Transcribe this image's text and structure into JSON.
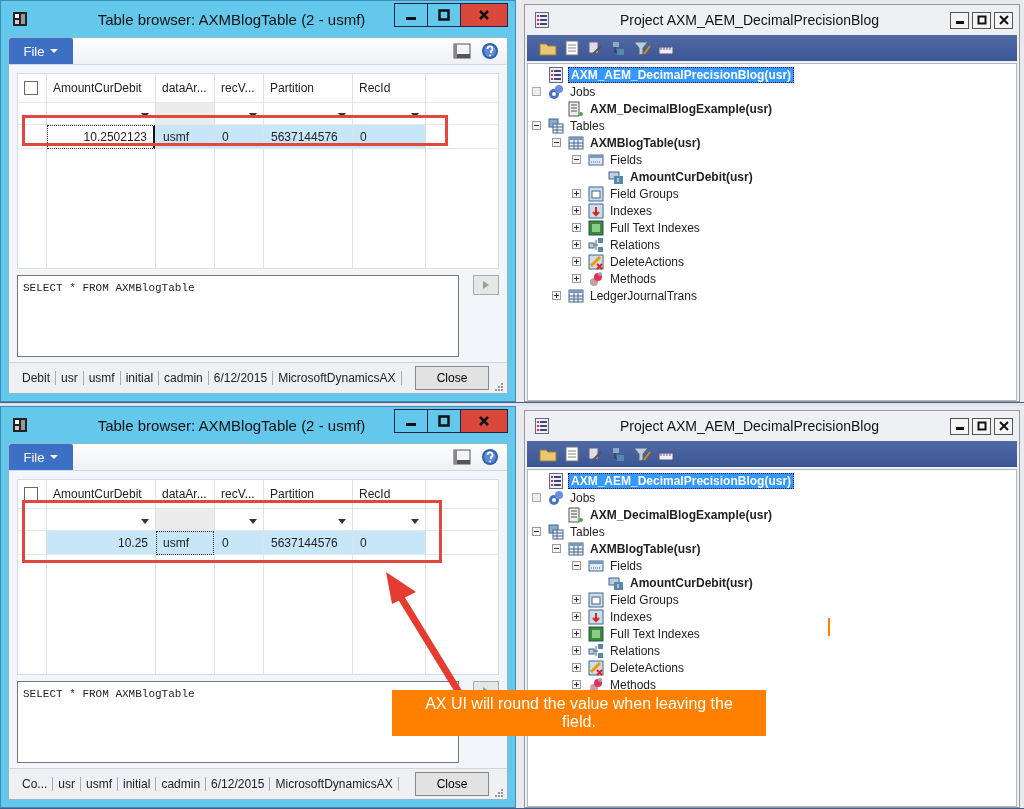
{
  "panels": [
    {
      "table_browser": {
        "title": "Table browser: AXMBlogTable (2 - usmf)",
        "file_menu": "File",
        "all_checked": false,
        "columns": [
          {
            "label": "AmountCurDebit",
            "filterable": true
          },
          {
            "label": "dataAr...",
            "filterable": false
          },
          {
            "label": "recV...",
            "filterable": true
          },
          {
            "label": "Partition",
            "filterable": true
          },
          {
            "label": "RecId",
            "filterable": true
          }
        ],
        "rows": [
          {
            "selected": true,
            "cells": [
              {
                "text": "10.2502123",
                "focused": true,
                "editing": true
              },
              {
                "text": "usmf",
                "focused": false,
                "editing": false
              },
              {
                "text": "0",
                "focused": false,
                "editing": false
              },
              {
                "text": "5637144576",
                "focused": false,
                "editing": false
              },
              {
                "text": "0",
                "focused": false,
                "editing": false
              }
            ]
          }
        ],
        "query": "SELECT * FROM AXMBlogTable",
        "status_fields": [
          "Debit",
          "usr",
          "usmf",
          "initial",
          "cadmin",
          "6/12/2015",
          "MicrosoftDynamicsAX"
        ],
        "close_button": "Close"
      },
      "project": {
        "title": "Project AXM_AEM_DecimalPrecisionBlog",
        "tree": [
          {
            "label": "AXM_AEM_DecimalPrecisionBlog(usr)",
            "kind": "project",
            "bold": true,
            "selected": true
          },
          {
            "label": "Jobs",
            "kind": "jobs",
            "bold": false,
            "selected": false,
            "empty_box": true,
            "children": [
              {
                "label": "AXM_DecimalBlogExample(usr)",
                "kind": "job",
                "bold": true,
                "selected": false
              }
            ]
          },
          {
            "label": "Tables",
            "kind": "tables",
            "bold": false,
            "selected": false,
            "expanded": true,
            "children": [
              {
                "label": "AXMBlogTable(usr)",
                "kind": "table",
                "bold": true,
                "selected": false,
                "expanded": true,
                "children": [
                  {
                    "label": "Fields",
                    "kind": "fields",
                    "bold": false,
                    "selected": false,
                    "expanded": true,
                    "children": [
                      {
                        "label": "AmountCurDebit(usr)",
                        "kind": "field",
                        "bold": true,
                        "selected": false
                      }
                    ]
                  },
                  {
                    "label": "Field Groups",
                    "kind": "field-groups",
                    "bold": false,
                    "selected": false,
                    "expanded": false
                  },
                  {
                    "label": "Indexes",
                    "kind": "indexes",
                    "bold": false,
                    "selected": false,
                    "expanded": false
                  },
                  {
                    "label": "Full Text Indexes",
                    "kind": "fulltext",
                    "bold": false,
                    "selected": false,
                    "expanded": false
                  },
                  {
                    "label": "Relations",
                    "kind": "relations",
                    "bold": false,
                    "selected": false,
                    "expanded": false
                  },
                  {
                    "label": "DeleteActions",
                    "kind": "delete-actions",
                    "bold": false,
                    "selected": false,
                    "expanded": false
                  },
                  {
                    "label": "Methods",
                    "kind": "methods",
                    "bold": false,
                    "selected": false,
                    "expanded": false
                  }
                ]
              },
              {
                "label": "LedgerJournalTrans",
                "kind": "table",
                "bold": false,
                "selected": false,
                "expanded": false
              }
            ]
          }
        ]
      }
    },
    {
      "table_browser": {
        "title": "Table browser: AXMBlogTable (2 - usmf)",
        "file_menu": "File",
        "all_checked": false,
        "columns": [
          {
            "label": "AmountCurDebit",
            "filterable": true
          },
          {
            "label": "dataAr...",
            "filterable": false
          },
          {
            "label": "recV...",
            "filterable": true
          },
          {
            "label": "Partition",
            "filterable": true
          },
          {
            "label": "RecId",
            "filterable": true
          }
        ],
        "rows": [
          {
            "selected": true,
            "cells": [
              {
                "text": "10.25",
                "focused": false,
                "editing": false
              },
              {
                "text": "usmf",
                "focused": true,
                "editing": false
              },
              {
                "text": "0",
                "focused": false,
                "editing": false
              },
              {
                "text": "5637144576",
                "focused": false,
                "editing": false
              },
              {
                "text": "0",
                "focused": false,
                "editing": false
              }
            ]
          }
        ],
        "query": "SELECT * FROM AXMBlogTable",
        "status_fields": [
          "Co...",
          "usr",
          "usmf",
          "initial",
          "cadmin",
          "6/12/2015",
          "MicrosoftDynamicsAX"
        ],
        "close_button": "Close"
      },
      "project": {
        "title": "Project AXM_AEM_DecimalPrecisionBlog",
        "tree": [
          {
            "label": "AXM_AEM_DecimalPrecisionBlog(usr)",
            "kind": "project",
            "bold": true,
            "selected": true
          },
          {
            "label": "Jobs",
            "kind": "jobs",
            "bold": false,
            "selected": false,
            "empty_box": true,
            "children": [
              {
                "label": "AXM_DecimalBlogExample(usr)",
                "kind": "job",
                "bold": true,
                "selected": false
              }
            ]
          },
          {
            "label": "Tables",
            "kind": "tables",
            "bold": false,
            "selected": false,
            "expanded": true,
            "children": [
              {
                "label": "AXMBlogTable(usr)",
                "kind": "table",
                "bold": true,
                "selected": false,
                "expanded": true,
                "children": [
                  {
                    "label": "Fields",
                    "kind": "fields",
                    "bold": false,
                    "selected": false,
                    "expanded": true,
                    "children": [
                      {
                        "label": "AmountCurDebit(usr)",
                        "kind": "field",
                        "bold": true,
                        "selected": false
                      }
                    ]
                  },
                  {
                    "label": "Field Groups",
                    "kind": "field-groups",
                    "bold": false,
                    "selected": false,
                    "expanded": false
                  },
                  {
                    "label": "Indexes",
                    "kind": "indexes",
                    "bold": false,
                    "selected": false,
                    "expanded": false
                  },
                  {
                    "label": "Full Text Indexes",
                    "kind": "fulltext",
                    "bold": false,
                    "selected": false,
                    "expanded": false
                  },
                  {
                    "label": "Relations",
                    "kind": "relations",
                    "bold": false,
                    "selected": false,
                    "expanded": false
                  },
                  {
                    "label": "DeleteActions",
                    "kind": "delete-actions",
                    "bold": false,
                    "selected": false,
                    "expanded": false
                  },
                  {
                    "label": "Methods",
                    "kind": "methods",
                    "bold": false,
                    "selected": false,
                    "expanded": false
                  }
                ]
              }
            ]
          }
        ]
      },
      "callout": {
        "text": "AX UI will round the value when leaving the field."
      }
    }
  ]
}
